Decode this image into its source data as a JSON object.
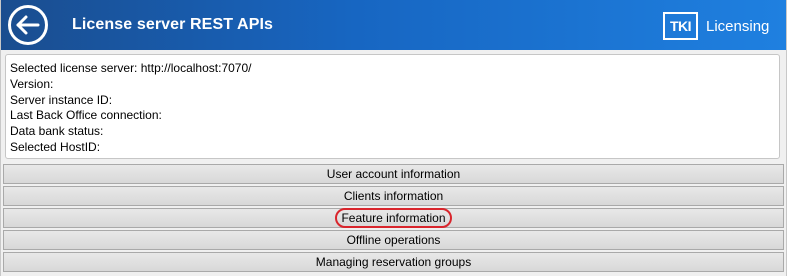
{
  "header": {
    "title": "License server REST APIs",
    "back_icon": "back-arrow-icon",
    "logo_text": "TKI",
    "brand_label": "Licensing",
    "background_color": "#1766c2"
  },
  "info": {
    "selected_server": "Selected license server: http://localhost:7070/",
    "version": "Version:",
    "server_instance_id": "Server instance ID:",
    "last_back_office": "Last Back Office connection:",
    "data_bank_status": "Data bank status:",
    "selected_hostid": "Selected HostID:"
  },
  "buttons": {
    "user_account": "User account information",
    "clients": "Clients information",
    "feature": "Feature information",
    "offline": "Offline operations",
    "reservation_groups": "Managing reservation groups"
  },
  "highlight": {
    "target": "Feature information",
    "color": "#d9252c"
  }
}
